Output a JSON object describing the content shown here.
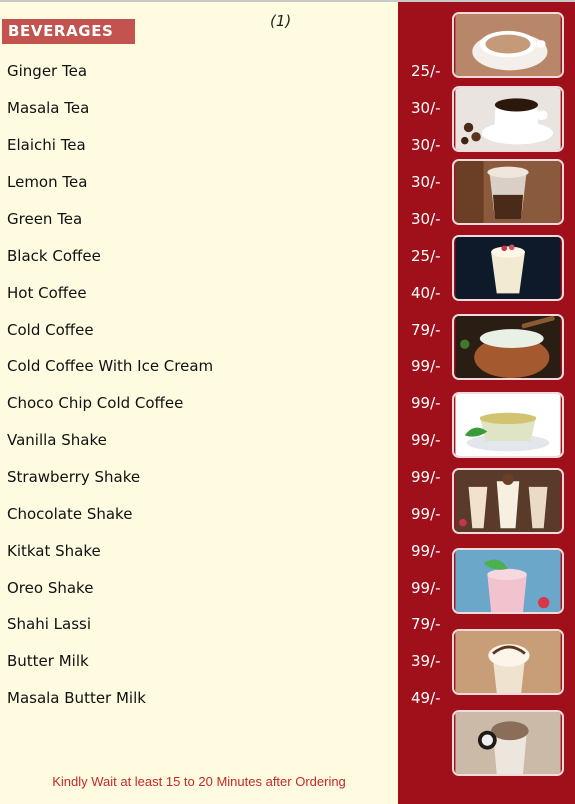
{
  "header": {
    "section_title": "BEVERAGES",
    "page_number": "(1)"
  },
  "menu": {
    "items": [
      {
        "name": "Ginger Tea",
        "price": "25/-"
      },
      {
        "name": "Masala Tea",
        "price": "30/-"
      },
      {
        "name": "Elaichi Tea",
        "price": "30/-"
      },
      {
        "name": "Lemon Tea",
        "price": "30/-"
      },
      {
        "name": "Green Tea",
        "price": "30/-"
      },
      {
        "name": "Black Coffee",
        "price": "25/-"
      },
      {
        "name": "Hot Coffee",
        "price": "40/-"
      },
      {
        "name": "Cold Coffee",
        "price": "79/-"
      },
      {
        "name": "Cold Coffee With Ice Cream",
        "price": "99/-"
      },
      {
        "name": "Choco Chip Cold Coffee",
        "price": "99/-"
      },
      {
        "name": "Vanilla Shake",
        "price": "99/-"
      },
      {
        "name": "Strawberry Shake",
        "price": "99/-"
      },
      {
        "name": "Chocolate Shake",
        "price": "99/-"
      },
      {
        "name": "Kitkat Shake",
        "price": "99/-"
      },
      {
        "name": "Oreo Shake",
        "price": "99/-"
      },
      {
        "name": "Shahi Lassi",
        "price": "79/-"
      },
      {
        "name": "Butter Milk",
        "price": "39/-"
      },
      {
        "name": "Masala Butter Milk",
        "price": "49/-"
      }
    ]
  },
  "footer": {
    "note": "Kindly Wait at least 15 to 20 Minutes after Ordering"
  },
  "photos": [
    "tea-cup-photo",
    "black-coffee-cup-photo",
    "iced-coffee-glass-photo",
    "dessert-shake-photo",
    "lassi-clay-pot-photo",
    "green-tea-cup-photo",
    "milkshakes-photo",
    "strawberry-shake-photo",
    "cream-shake-photo",
    "oreo-shake-photo"
  ],
  "colors": {
    "background": "#fefbe1",
    "side_panel": "#a0101a",
    "badge": "#c2534f",
    "note_text": "#c62828"
  }
}
